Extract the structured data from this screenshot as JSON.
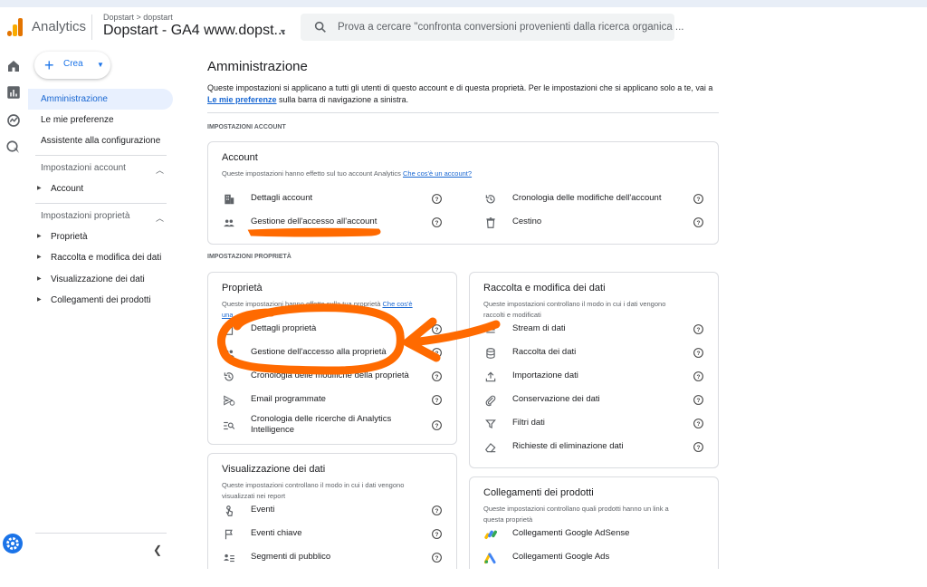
{
  "header": {
    "app_name": "Analytics",
    "breadcrumb": "Dopstart  >  dopstart",
    "property_name": "Dopstart - GA4 www.dopst...",
    "search_placeholder": "Prova a cercare \"confronta conversioni provenienti dalla ricerca organica ..."
  },
  "rail": [
    "home-icon",
    "reports-icon",
    "explore-icon",
    "advertising-icon",
    "admin-gear-icon"
  ],
  "sidebar": {
    "create_label": "Crea",
    "items": [
      "Amministrazione",
      "Le mie preferenze",
      "Assistente alla configurazione"
    ],
    "account_section": "Impostazioni account",
    "account_items": [
      "Account"
    ],
    "property_section": "Impostazioni proprietà",
    "property_items": [
      "Proprietà",
      "Raccolta e modifica dei dati",
      "Visualizzazione dei dati",
      "Collegamenti dei prodotti"
    ]
  },
  "main": {
    "title": "Amministrazione",
    "desc_part1": "Queste impostazioni si applicano a tutti gli utenti di questo account e di questa proprietà. Per le impostazioni che si applicano solo a te, vai a",
    "desc_link": "Le mie preferenze",
    "desc_part2": "sulla barra di navigazione a sinistra.",
    "account_section_label": "IMPOSTAZIONI ACCOUNT",
    "property_section_label": "IMPOSTAZIONI PROPRIETÀ",
    "account_card": {
      "title": "Account",
      "desc": "Queste impostazioni hanno effetto sul tuo account Analytics",
      "desc_link": "Che cos'è un account?",
      "items": [
        "Dettagli account",
        "Gestione dell'accesso all'account",
        "Cronologia delle modifiche dell'account",
        "Cestino"
      ]
    },
    "property_card": {
      "title": "Proprietà",
      "desc": "Queste impostazioni hanno effetto sulla tua proprietà",
      "desc_link": "Che cos'è",
      "desc_link2": "una",
      "items": [
        "Dettagli proprietà",
        "Gestione dell'accesso alla proprietà",
        "Cronologia delle modifiche della proprietà",
        "Email programmate",
        "Cronologia delle ricerche di Analytics",
        "Intelligence"
      ]
    },
    "data_collection_card": {
      "title": "Raccolta e modifica dei dati",
      "desc1": "Queste impostazioni controllano il modo in cui i dati vengono",
      "desc2": "raccolti e modificati",
      "items": [
        "Stream di dati",
        "Raccolta dei dati",
        "Importazione dati",
        "Conservazione dei dati",
        "Filtri dati",
        "Richieste di eliminazione dati"
      ]
    },
    "data_display_card": {
      "title": "Visualizzazione dei dati",
      "desc1": "Queste impostazioni controllano il modo in cui i dati vengono",
      "desc2": "visualizzati nei report",
      "items": [
        "Eventi",
        "Eventi chiave",
        "Segmenti di pubblico"
      ]
    },
    "product_links_card": {
      "title": "Collegamenti dei prodotti",
      "desc1": "Queste impostazioni controllano quali prodotti hanno un link a",
      "desc2": "questa proprietà",
      "items": [
        "Collegamenti Google AdSense",
        "Collegamenti Google Ads"
      ]
    }
  },
  "colors": {
    "accent": "#1a73e8",
    "annotation": "#ff6a00",
    "ga_orange": "#f9ab00",
    "ga_dark": "#e37400"
  }
}
